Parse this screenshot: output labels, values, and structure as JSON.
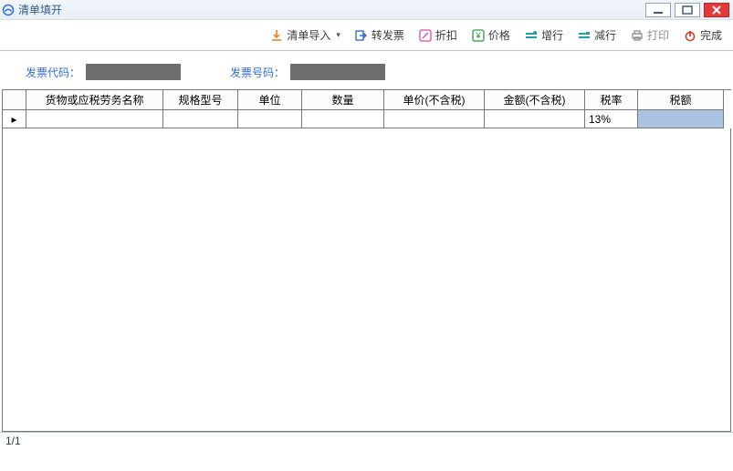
{
  "window": {
    "title": "清单填开"
  },
  "toolbar": {
    "import": "清单导入",
    "to_invoice": "转发票",
    "discount": "折扣",
    "price": "价格",
    "add_row": "增行",
    "del_row": "减行",
    "print": "打印",
    "finish": "完成"
  },
  "fields": {
    "invoice_code_label": "发票代码：",
    "invoice_no_label": "发票号码："
  },
  "columns": {
    "name": "货物或应税劳务名称",
    "spec": "规格型号",
    "unit": "单位",
    "qty": "数量",
    "unit_price": "单价(不含税)",
    "amount": "金额(不含税)",
    "tax_rate": "税率",
    "tax": "税额"
  },
  "rows": [
    {
      "name": "",
      "spec": "",
      "unit": "",
      "qty": "",
      "unit_price": "",
      "amount": "",
      "tax_rate": "13%",
      "tax": ""
    }
  ],
  "status": {
    "page": "1/1"
  }
}
